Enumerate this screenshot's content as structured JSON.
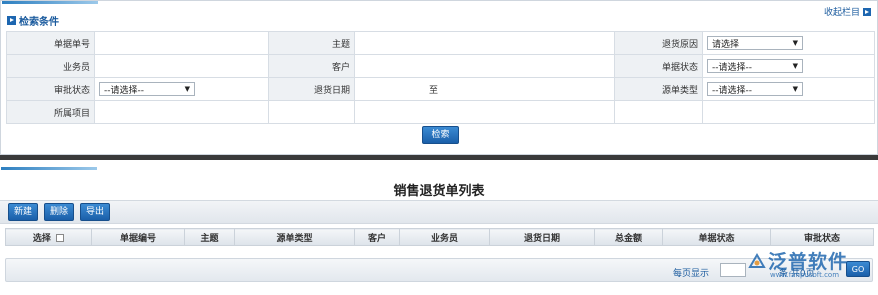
{
  "search_panel": {
    "title": "检索条件",
    "collapse_label": "收起栏目",
    "rows": [
      [
        {
          "label": "单据单号",
          "type": "text",
          "value": ""
        },
        {
          "label": "主题",
          "type": "text",
          "value": ""
        },
        {
          "label": "退货原因",
          "type": "select",
          "value": "请选择"
        }
      ],
      [
        {
          "label": "业务员",
          "type": "text",
          "value": ""
        },
        {
          "label": "客户",
          "type": "text",
          "value": ""
        },
        {
          "label": "单据状态",
          "type": "select",
          "value": "--请选择--"
        }
      ],
      [
        {
          "label": "审批状态",
          "type": "select",
          "value": "--请选择--"
        },
        {
          "label": "退货日期",
          "type": "daterange",
          "separator": "至"
        },
        {
          "label": "源单类型",
          "type": "select",
          "value": "--请选择--"
        }
      ],
      [
        {
          "label": "所属项目",
          "type": "text",
          "value": ""
        }
      ]
    ],
    "search_button": "检索"
  },
  "list_panel": {
    "title": "销售退货单列表",
    "toolbar": {
      "new": "新建",
      "delete": "删除",
      "export": "导出"
    },
    "columns": [
      "选择",
      "单据编号",
      "主题",
      "源单类型",
      "客户",
      "业务员",
      "退货日期",
      "总金额",
      "单据状态",
      "审批状态"
    ]
  },
  "pager": {
    "per_page_label": "每页显示",
    "tail_text": "条 共0页",
    "go_label": "GO"
  },
  "watermark": {
    "brand": "泛普软件",
    "url": "www.fanpusoft.com"
  },
  "colors": {
    "accent": "#1d66b0",
    "divider": "#3a3a3a"
  }
}
